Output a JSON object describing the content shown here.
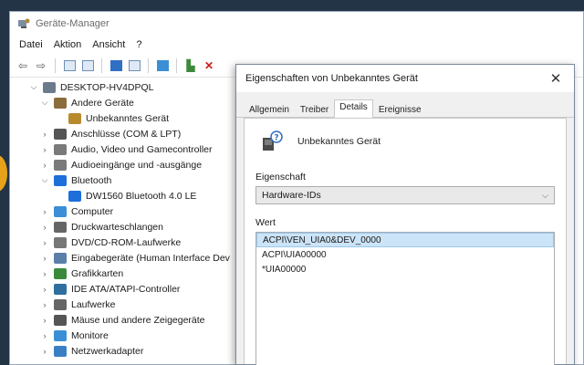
{
  "window": {
    "title": "Geräte-Manager"
  },
  "menu": [
    "Datei",
    "Aktion",
    "Ansicht",
    "?"
  ],
  "tree": [
    {
      "label": "DESKTOP-HV4DPQL",
      "level": 0,
      "expander": "v",
      "icon_color": "#6b7a8c"
    },
    {
      "label": "Andere Geräte",
      "level": 1,
      "expander": "v",
      "icon_color": "#8a6d3b"
    },
    {
      "label": "Unbekanntes Gerät",
      "level": 2,
      "expander": "",
      "icon_color": "#b88a2e"
    },
    {
      "label": "Anschlüsse (COM & LPT)",
      "level": 1,
      "expander": ">",
      "icon_color": "#555555"
    },
    {
      "label": "Audio, Video und Gamecontroller",
      "level": 1,
      "expander": ">",
      "icon_color": "#7a7a7a"
    },
    {
      "label": "Audioeingänge und -ausgänge",
      "level": 1,
      "expander": ">",
      "icon_color": "#7a7a7a"
    },
    {
      "label": "Bluetooth",
      "level": 1,
      "expander": "v",
      "icon_color": "#1e6fd9"
    },
    {
      "label": "DW1560 Bluetooth 4.0 LE",
      "level": 2,
      "expander": "",
      "icon_color": "#1e6fd9"
    },
    {
      "label": "Computer",
      "level": 1,
      "expander": ">",
      "icon_color": "#3a8fd6"
    },
    {
      "label": "Druckwarteschlangen",
      "level": 1,
      "expander": ">",
      "icon_color": "#666666"
    },
    {
      "label": "DVD/CD-ROM-Laufwerke",
      "level": 1,
      "expander": ">",
      "icon_color": "#777777"
    },
    {
      "label": "Eingabegeräte (Human Interface Dev",
      "level": 1,
      "expander": ">",
      "icon_color": "#5a7fa8"
    },
    {
      "label": "Grafikkarten",
      "level": 1,
      "expander": ">",
      "icon_color": "#3b8a3b"
    },
    {
      "label": "IDE ATA/ATAPI-Controller",
      "level": 1,
      "expander": ">",
      "icon_color": "#2f6f9f"
    },
    {
      "label": "Laufwerke",
      "level": 1,
      "expander": ">",
      "icon_color": "#666666"
    },
    {
      "label": "Mäuse und andere Zeigegeräte",
      "level": 1,
      "expander": ">",
      "icon_color": "#555555"
    },
    {
      "label": "Monitore",
      "level": 1,
      "expander": ">",
      "icon_color": "#3a8fd6"
    },
    {
      "label": "Netzwerkadapter",
      "level": 1,
      "expander": ">",
      "icon_color": "#3a7fc4"
    }
  ],
  "dialog": {
    "title": "Eigenschaften von Unbekanntes Gerät",
    "close_label": "✕",
    "tabs": [
      {
        "label": "Allgemein",
        "active": false
      },
      {
        "label": "Treiber",
        "active": false
      },
      {
        "label": "Details",
        "active": true
      },
      {
        "label": "Ereignisse",
        "active": false
      }
    ],
    "device_name": "Unbekanntes Gerät",
    "property_label": "Eigenschaft",
    "property_value": "Hardware-IDs",
    "value_label": "Wert",
    "values": [
      {
        "text": "ACPI\\VEN_UIA0&DEV_0000",
        "selected": true
      },
      {
        "text": "ACPI\\UIA00000",
        "selected": false
      },
      {
        "text": "*UIA00000",
        "selected": false
      }
    ]
  }
}
